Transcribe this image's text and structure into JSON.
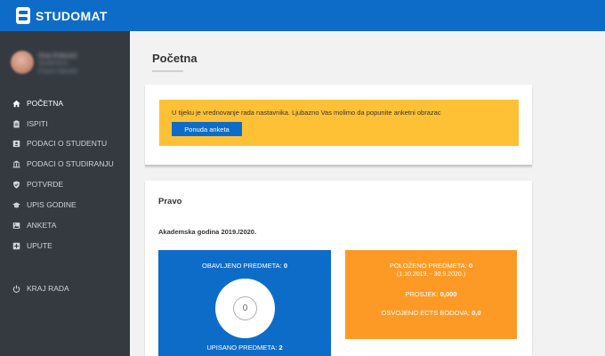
{
  "app": {
    "name": "STUDOMAT",
    "brand_color": "#0e6cc9",
    "logo_icon": "studomat-logo-icon"
  },
  "user": {
    "name": "Ana Anković",
    "line1": "Studentica",
    "line2": "Pravni fakultet"
  },
  "sidebar": {
    "items": [
      {
        "label": "POČETNA",
        "icon": "home-icon",
        "active": true
      },
      {
        "label": "ISPITI",
        "icon": "clipboard-icon"
      },
      {
        "label": "PODACI O STUDENTU",
        "icon": "id-card-icon"
      },
      {
        "label": "PODACI O STUDIRANJU",
        "icon": "university-icon"
      },
      {
        "label": "POTVRDE",
        "icon": "shield-icon"
      },
      {
        "label": "UPIS GODINE",
        "icon": "graduation-cap-icon"
      },
      {
        "label": "ANKETA",
        "icon": "image-icon"
      },
      {
        "label": "UPUTE",
        "icon": "plus-square-icon"
      }
    ],
    "logout": {
      "label": "KRAJ RADA",
      "icon": "power-icon"
    }
  },
  "page": {
    "title": "Početna"
  },
  "alert": {
    "text": "U tijeku je vrednovanje rada nastavnika. Ljubazno Vas molimo da popunite anketni obrazac",
    "button": "Ponuda anketa",
    "color": "#fec136"
  },
  "program": {
    "title": "Pravo",
    "year_label": "Akademska godina 2019./2020."
  },
  "stats_blue": {
    "completed_label": "OBAVLJENO PREDMETA:",
    "completed_value": "0",
    "donut_value": "0",
    "enrolled_label": "UPISANO PREDMETA:",
    "enrolled_value": "2",
    "color": "#0e6cc9"
  },
  "stats_orange": {
    "passed_label": "POLOŽENO PREDMETA:",
    "passed_value": "0",
    "period": "(1.10.2019. - 30.9.2020.)",
    "average_label": "PROSJEK:",
    "average_value": "0,000",
    "ects_label": "OSVOJENO ECTS BODOVA:",
    "ects_value": "0,0",
    "color": "#fd9a26"
  }
}
